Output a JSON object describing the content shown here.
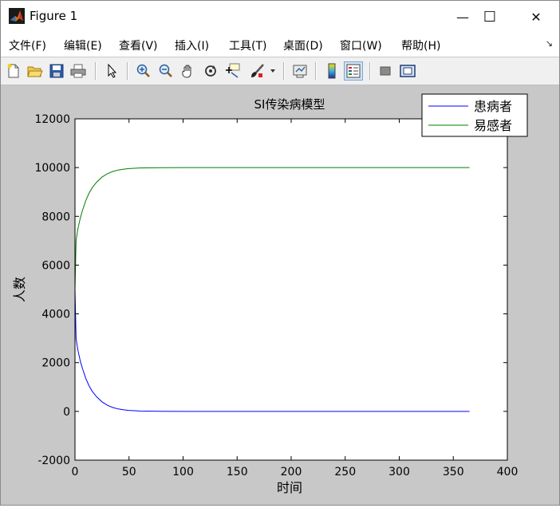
{
  "window": {
    "title": "Figure 1",
    "controls": {
      "minimize": "—",
      "maximize": "☐",
      "close": "✕"
    }
  },
  "menu": {
    "items": [
      "文件(F)",
      "编辑(E)",
      "查看(V)",
      "插入(I)",
      "工具(T)",
      "桌面(D)",
      "窗口(W)",
      "帮助(H)"
    ],
    "corner_glyph": "↘"
  },
  "toolbar": {
    "buttons": [
      {
        "icon": "new-figure-icon"
      },
      {
        "icon": "open-file-icon"
      },
      {
        "icon": "save-icon"
      },
      {
        "icon": "print-icon"
      },
      {
        "icon": "pointer-icon"
      },
      {
        "icon": "zoom-in-icon"
      },
      {
        "icon": "zoom-out-icon"
      },
      {
        "icon": "pan-hand-icon"
      },
      {
        "icon": "rotate-3d-icon"
      },
      {
        "icon": "data-cursor-icon"
      },
      {
        "icon": "brush-icon"
      },
      {
        "icon": "link-plot-icon"
      },
      {
        "icon": "colorbar-icon"
      },
      {
        "icon": "legend-icon",
        "pressed": true
      },
      {
        "icon": "hide-plot-tools-icon"
      },
      {
        "icon": "show-plot-tools-icon"
      }
    ]
  },
  "colors": {
    "figure_bg": "#c8c8c8",
    "axes_bg": "#ffffff",
    "series_infected": "#0000ff",
    "series_susceptible": "#007f00"
  },
  "chart_data": {
    "type": "line",
    "title": "SI传染病模型",
    "xlabel": "时间",
    "ylabel": "人数",
    "xlim": [
      0,
      400
    ],
    "ylim": [
      -2000,
      12000
    ],
    "xticks": [
      0,
      50,
      100,
      150,
      200,
      250,
      300,
      350,
      400
    ],
    "yticks": [
      -2000,
      0,
      2000,
      4000,
      6000,
      8000,
      10000,
      12000
    ],
    "grid": false,
    "legend_position": "top-right",
    "series": [
      {
        "name": "患病者",
        "color": "#0000ff",
        "x": [
          0,
          1,
          2,
          3,
          5,
          7,
          10,
          13,
          16,
          20,
          25,
          30,
          35,
          40,
          45,
          50,
          60,
          80,
          100,
          150,
          200,
          250,
          300,
          365
        ],
        "y": [
          5000,
          3000,
          2700,
          2450,
          2050,
          1750,
          1350,
          1050,
          820,
          600,
          390,
          250,
          160,
          100,
          65,
          40,
          15,
          3,
          0,
          0,
          0,
          0,
          0,
          0
        ]
      },
      {
        "name": "易感者",
        "color": "#007f00",
        "x": [
          0,
          1,
          2,
          3,
          5,
          7,
          10,
          13,
          16,
          20,
          25,
          30,
          35,
          40,
          45,
          50,
          60,
          80,
          100,
          150,
          200,
          250,
          300,
          365
        ],
        "y": [
          5000,
          7000,
          7300,
          7550,
          7950,
          8250,
          8650,
          8950,
          9180,
          9400,
          9610,
          9750,
          9840,
          9900,
          9935,
          9960,
          9985,
          9997,
          10000,
          10000,
          10000,
          10000,
          10000,
          10000
        ]
      }
    ]
  }
}
